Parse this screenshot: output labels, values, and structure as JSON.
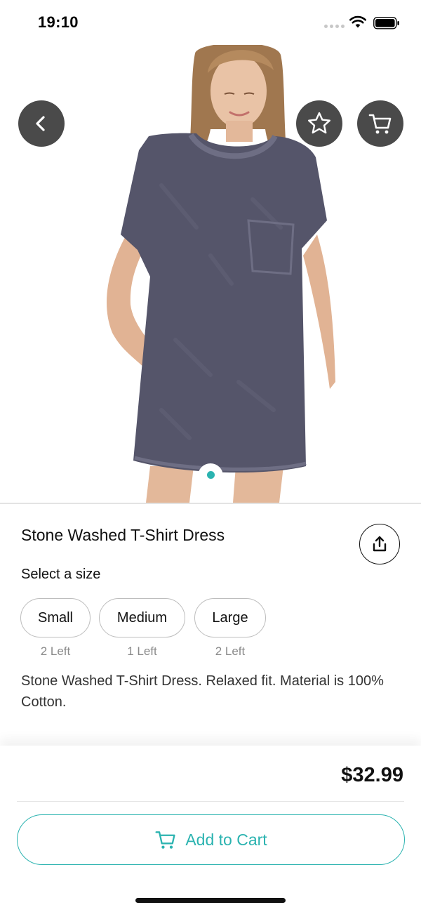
{
  "status_bar": {
    "time": "19:10",
    "icons": [
      "signal-dots",
      "wifi-icon",
      "battery-icon"
    ]
  },
  "hero": {
    "image_alt": "Woman wearing a grey stone washed t-shirt dress",
    "page_indicator": {
      "current": 1,
      "total": 1
    },
    "buttons": {
      "back_icon": "chevron-left-icon",
      "favorite_icon": "star-icon",
      "cart_icon": "cart-icon"
    }
  },
  "product": {
    "title": "Stone Washed T-Shirt Dress",
    "share_icon": "share-icon",
    "size_label": "Select a size",
    "sizes": [
      {
        "label": "Small",
        "stock": "2 Left"
      },
      {
        "label": "Medium",
        "stock": "1 Left"
      },
      {
        "label": "Large",
        "stock": "2 Left"
      }
    ],
    "description": "Stone Washed T-Shirt Dress. Relaxed fit. Material is 100% Cotton."
  },
  "checkout": {
    "price": "$32.99",
    "add_to_cart_label": "Add to Cart",
    "add_to_cart_icon": "cart-icon"
  },
  "colors": {
    "accent": "#2bb3b0",
    "overlay_button": "#4a4a4a",
    "dress": "#55556a"
  }
}
